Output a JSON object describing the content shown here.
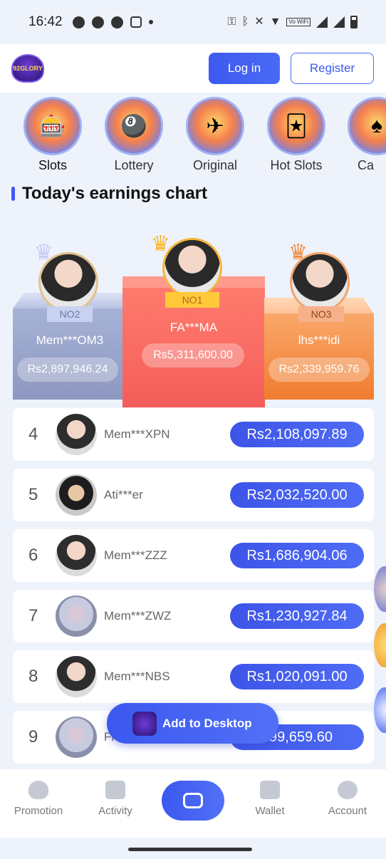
{
  "status_bar": {
    "time": "16:42",
    "wifi_tag": "Vo WiFi"
  },
  "header": {
    "logo_text": "92GLORY",
    "login_label": "Log in",
    "register_label": "Register"
  },
  "categories": [
    {
      "label": "Slots",
      "icon": "slots-icon"
    },
    {
      "label": "Lottery",
      "icon": "lottery-icon"
    },
    {
      "label": "Original",
      "icon": "original-icon"
    },
    {
      "label": "Hot Slots",
      "icon": "hot-slots-icon"
    },
    {
      "label": "Ca",
      "icon": "casino-icon"
    }
  ],
  "section_title": "Today's earnings chart",
  "podium": {
    "first": {
      "badge": "NO1",
      "name": "FA***MA",
      "amount": "Rs5,311,600.00"
    },
    "second": {
      "badge": "NO2",
      "name": "Mem***OM3",
      "amount": "Rs2,897,946.24"
    },
    "third": {
      "badge": "NO3",
      "name": "lhs***idi",
      "amount": "Rs2,339,959.76"
    }
  },
  "rankings": [
    {
      "rank": "4",
      "name": "Mem***XPN",
      "amount": "Rs2,108,097.89"
    },
    {
      "rank": "5",
      "name": "Ati***er",
      "amount": "Rs2,032,520.00"
    },
    {
      "rank": "6",
      "name": "Mem***ZZZ",
      "amount": "Rs1,686,904.06"
    },
    {
      "rank": "7",
      "name": "Mem***ZWZ",
      "amount": "Rs1,230,927.84"
    },
    {
      "rank": "8",
      "name": "Mem***NBS",
      "amount": "Rs1,020,091.00"
    },
    {
      "rank": "9",
      "name": "Fr",
      "amount": "599,659.60"
    }
  ],
  "add_to_desktop_label": "Add to Desktop",
  "bottom_nav": {
    "promotion": "Promotion",
    "activity": "Activity",
    "wallet": "Wallet",
    "account": "Account"
  }
}
